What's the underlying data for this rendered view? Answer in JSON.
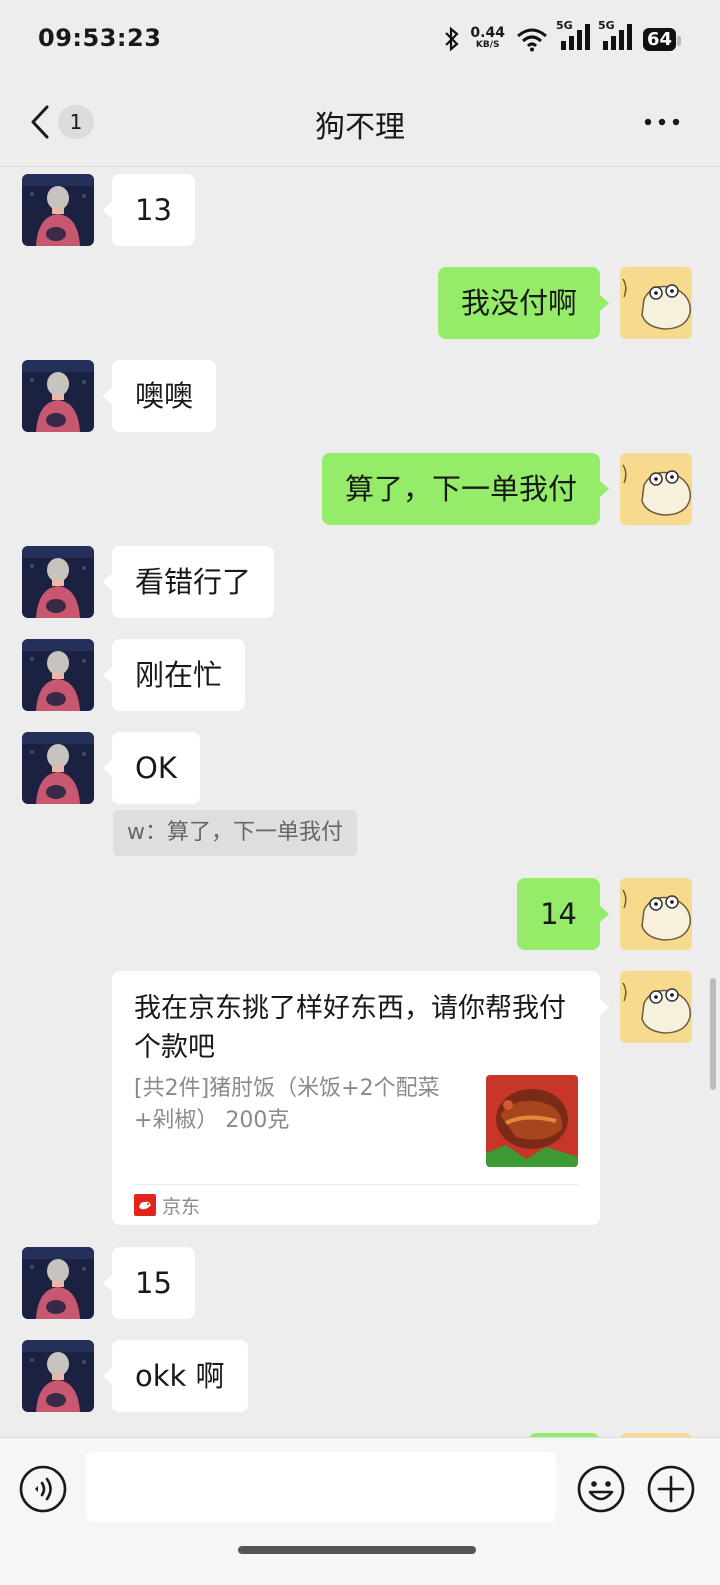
{
  "status_bar": {
    "time": "09:53:23",
    "net_speed": "0.44",
    "net_unit": "KB/S",
    "sim1": "5G",
    "sim2": "5G",
    "battery": "64"
  },
  "header": {
    "unread_count": "1",
    "title": "狗不理"
  },
  "messages": [
    {
      "side": "in",
      "text": "13"
    },
    {
      "side": "out",
      "text": "我没付啊"
    },
    {
      "side": "in",
      "text": "噢噢"
    },
    {
      "side": "out",
      "text": "算了，下一单我付"
    },
    {
      "side": "in",
      "text": "看错行了"
    },
    {
      "side": "in",
      "text": "刚在忙"
    },
    {
      "side": "in",
      "text": "OK"
    },
    {
      "side": "out",
      "text": "14"
    },
    {
      "side": "in",
      "text": "15"
    },
    {
      "side": "in",
      "text": "okk 啊"
    }
  ],
  "quote": {
    "text": "w：算了，下一单我付"
  },
  "card": {
    "title": "我在京东挑了样好东西，请你帮我付个款吧",
    "desc": "[共2件]猪肘饭（米饭+2个配菜+剁椒） 200克",
    "source": "京东"
  },
  "colors": {
    "background": "#EDEDED",
    "outgoing_bubble": "#95EC69",
    "incoming_bubble": "#FFFFFF",
    "jd_red": "#E1251B"
  },
  "icons": {
    "back": "chevron-left-icon",
    "more": "more-dots-icon",
    "voice": "voice-icon",
    "emoji": "emoji-icon",
    "plus": "plus-icon"
  }
}
